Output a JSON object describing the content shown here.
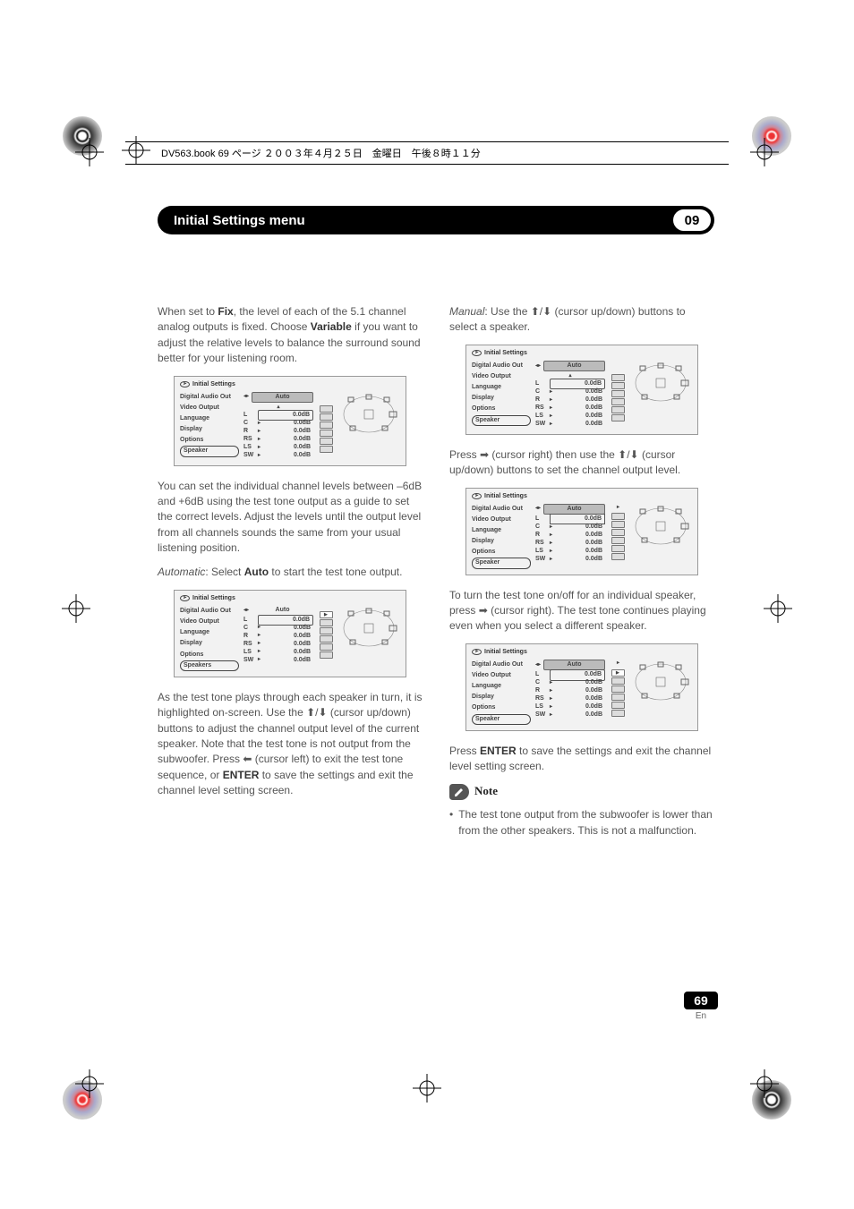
{
  "header": {
    "book_line": "DV563.book  69 ページ  ２００３年４月２５日　金曜日　午後８時１１分"
  },
  "title_bar": {
    "title": "Initial Settings menu",
    "chapter": "09"
  },
  "left_col": {
    "p1_pre": "When set to ",
    "p1_fix": "Fix",
    "p1_mid": ", the level of each of the 5.1 channel analog outputs is fixed. Choose ",
    "p1_var": "Variable",
    "p1_post": " if you want to adjust the relative levels to balance the surround sound better for your listening room.",
    "p2": "You can set the individual channel levels between –6dB and +6dB using the test tone output as a guide to set the correct levels. Adjust the levels until the output level from all channels sounds the same from your usual listening position.",
    "p3_em": "Automatic",
    "p3_mid": ": Select ",
    "p3_auto": "Auto",
    "p3_post": " to start the test tone output.",
    "p4_a": "As the test tone plays through each speaker in turn, it is highlighted on-screen. Use the ",
    "p4_b": " (cursor up/down) buttons to adjust the channel output level of the current speaker. Note that the test tone is not output from the subwoofer. Press ",
    "p4_c": " (cursor left) to exit the test tone sequence, or ",
    "p4_enter": "ENTER",
    "p4_d": " to save the settings and exit the channel level setting screen."
  },
  "right_col": {
    "p1_em": "Manual",
    "p1_mid": ": Use the ",
    "p1_post": " (cursor up/down) buttons to select a speaker.",
    "p2_a": "Press ",
    "p2_b": " (cursor right) then use the ",
    "p2_c": " (cursor up/down) buttons to set the channel output level.",
    "p3_a": "To turn the test tone on/off for an individual speaker, press ",
    "p3_b": " (cursor right). The test tone continues playing even when you select a different speaker.",
    "p4_a": "Press ",
    "p4_enter": "ENTER",
    "p4_b": " to save the settings and exit the channel level setting screen.",
    "note_label": "Note",
    "note_text": "The test tone output from the subwoofer is lower than from  the other speakers. This is not a malfunction."
  },
  "osd": {
    "title": "Initial Settings",
    "menu": [
      "Digital Audio Out",
      "Video Output",
      "Language",
      "Display",
      "Options",
      "Speaker"
    ],
    "sel_variant_a": "Speakers",
    "auto": "Auto",
    "channels": [
      "L",
      "C",
      "R",
      "RS",
      "LS",
      "SW"
    ],
    "value": "0.0dB"
  },
  "arrows": {
    "updown": "⬆/⬇",
    "left": "⬅",
    "right": "➡"
  },
  "page": {
    "num": "69",
    "lang": "En"
  }
}
